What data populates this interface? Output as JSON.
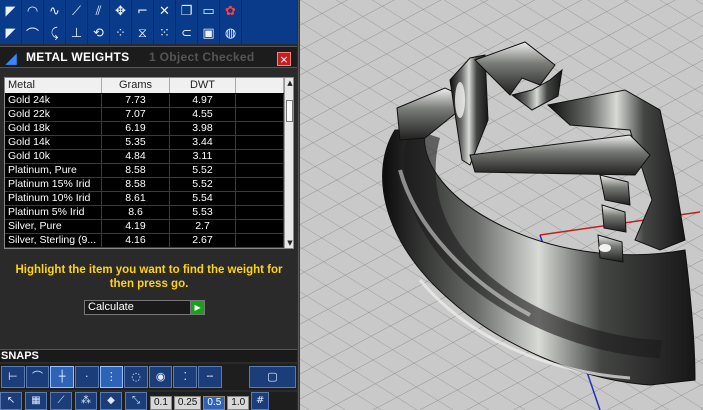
{
  "toolbar": {
    "row1_icons": [
      "fill-icon",
      "circle-icon",
      "curve-icon",
      "ruler-icon",
      "trim-icon",
      "move-icon",
      "corner-icon",
      "cross-icon",
      "layers-icon",
      "tablet-icon",
      "rose-icon"
    ],
    "row2_icons": [
      "fill-icon",
      "hook-icon",
      "arc-icon",
      "pin-icon",
      "revolve-icon",
      "nodes-icon",
      "mirror-icon",
      "scatter-icon",
      "link-icon",
      "box-icon",
      "globe-icon"
    ]
  },
  "metal_weights": {
    "title": "METAL WEIGHTS",
    "status": "1 Object Checked",
    "close_label": "×",
    "columns": [
      "Metal",
      "Grams",
      "DWT",
      ""
    ],
    "rows": [
      {
        "metal": "Gold 24k",
        "grams": "7.73",
        "dwt": "4.97"
      },
      {
        "metal": "Gold 22k",
        "grams": "7.07",
        "dwt": "4.55"
      },
      {
        "metal": "Gold 18k",
        "grams": "6.19",
        "dwt": "3.98"
      },
      {
        "metal": "Gold 14k",
        "grams": "5.35",
        "dwt": "3.44"
      },
      {
        "metal": "Gold 10k",
        "grams": "4.84",
        "dwt": "3.11"
      },
      {
        "metal": "Platinum, Pure",
        "grams": "8.58",
        "dwt": "5.52"
      },
      {
        "metal": "Platinum 15% Irid",
        "grams": "8.58",
        "dwt": "5.52"
      },
      {
        "metal": "Platinum 10% Irid",
        "grams": "8.61",
        "dwt": "5.54"
      },
      {
        "metal": "Platinum 5% Irid",
        "grams": "8.6",
        "dwt": "5.53"
      },
      {
        "metal": "Silver, Pure",
        "grams": "4.19",
        "dwt": "2.7"
      },
      {
        "metal": "Silver, Sterling (9...",
        "grams": "4.16",
        "dwt": "2.67"
      }
    ],
    "instruction_line1": "Highlight the item you want to find the weight for",
    "instruction_line2": "then press go.",
    "calculate_label": "Calculate",
    "go_label": "▶"
  },
  "snaps": {
    "label": "SNAPS",
    "buttons": [
      "snap-point-icon",
      "snap-curve-icon",
      "snap-mid-icon",
      "snap-dot-icon",
      "snap-end-icon",
      "snap-center-icon",
      "snap-circle-icon",
      "snap-grid-icon",
      "snap-line-icon"
    ],
    "active": [
      2,
      4
    ],
    "tolerance_values": [
      "0.1",
      "0.25",
      "0.5",
      "1.0"
    ],
    "active_tolerance": "0.5"
  },
  "colors": {
    "toolbar_blue": "#0a3a8a",
    "instruction_yellow": "#ffd21e",
    "go_green": "#1aa01a",
    "close_red": "#c02020",
    "viewport_bg": "#c9c9c9"
  }
}
